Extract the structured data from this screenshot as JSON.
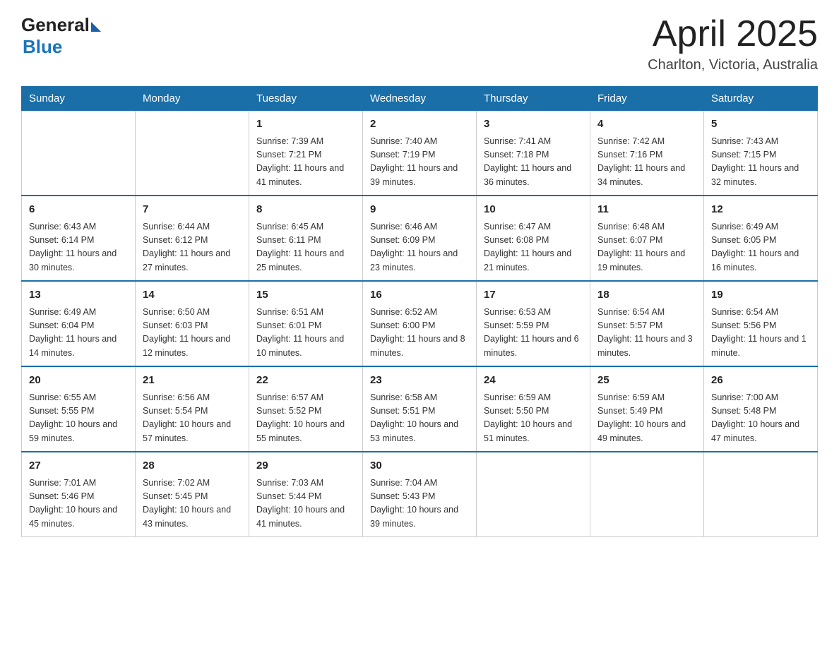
{
  "header": {
    "logo_general": "General",
    "logo_blue": "Blue",
    "title": "April 2025",
    "location": "Charlton, Victoria, Australia"
  },
  "days_of_week": [
    "Sunday",
    "Monday",
    "Tuesday",
    "Wednesday",
    "Thursday",
    "Friday",
    "Saturday"
  ],
  "weeks": [
    [
      null,
      null,
      {
        "day": "1",
        "sunrise": "7:39 AM",
        "sunset": "7:21 PM",
        "daylight": "11 hours and 41 minutes."
      },
      {
        "day": "2",
        "sunrise": "7:40 AM",
        "sunset": "7:19 PM",
        "daylight": "11 hours and 39 minutes."
      },
      {
        "day": "3",
        "sunrise": "7:41 AM",
        "sunset": "7:18 PM",
        "daylight": "11 hours and 36 minutes."
      },
      {
        "day": "4",
        "sunrise": "7:42 AM",
        "sunset": "7:16 PM",
        "daylight": "11 hours and 34 minutes."
      },
      {
        "day": "5",
        "sunrise": "7:43 AM",
        "sunset": "7:15 PM",
        "daylight": "11 hours and 32 minutes."
      }
    ],
    [
      {
        "day": "6",
        "sunrise": "6:43 AM",
        "sunset": "6:14 PM",
        "daylight": "11 hours and 30 minutes."
      },
      {
        "day": "7",
        "sunrise": "6:44 AM",
        "sunset": "6:12 PM",
        "daylight": "11 hours and 27 minutes."
      },
      {
        "day": "8",
        "sunrise": "6:45 AM",
        "sunset": "6:11 PM",
        "daylight": "11 hours and 25 minutes."
      },
      {
        "day": "9",
        "sunrise": "6:46 AM",
        "sunset": "6:09 PM",
        "daylight": "11 hours and 23 minutes."
      },
      {
        "day": "10",
        "sunrise": "6:47 AM",
        "sunset": "6:08 PM",
        "daylight": "11 hours and 21 minutes."
      },
      {
        "day": "11",
        "sunrise": "6:48 AM",
        "sunset": "6:07 PM",
        "daylight": "11 hours and 19 minutes."
      },
      {
        "day": "12",
        "sunrise": "6:49 AM",
        "sunset": "6:05 PM",
        "daylight": "11 hours and 16 minutes."
      }
    ],
    [
      {
        "day": "13",
        "sunrise": "6:49 AM",
        "sunset": "6:04 PM",
        "daylight": "11 hours and 14 minutes."
      },
      {
        "day": "14",
        "sunrise": "6:50 AM",
        "sunset": "6:03 PM",
        "daylight": "11 hours and 12 minutes."
      },
      {
        "day": "15",
        "sunrise": "6:51 AM",
        "sunset": "6:01 PM",
        "daylight": "11 hours and 10 minutes."
      },
      {
        "day": "16",
        "sunrise": "6:52 AM",
        "sunset": "6:00 PM",
        "daylight": "11 hours and 8 minutes."
      },
      {
        "day": "17",
        "sunrise": "6:53 AM",
        "sunset": "5:59 PM",
        "daylight": "11 hours and 6 minutes."
      },
      {
        "day": "18",
        "sunrise": "6:54 AM",
        "sunset": "5:57 PM",
        "daylight": "11 hours and 3 minutes."
      },
      {
        "day": "19",
        "sunrise": "6:54 AM",
        "sunset": "5:56 PM",
        "daylight": "11 hours and 1 minute."
      }
    ],
    [
      {
        "day": "20",
        "sunrise": "6:55 AM",
        "sunset": "5:55 PM",
        "daylight": "10 hours and 59 minutes."
      },
      {
        "day": "21",
        "sunrise": "6:56 AM",
        "sunset": "5:54 PM",
        "daylight": "10 hours and 57 minutes."
      },
      {
        "day": "22",
        "sunrise": "6:57 AM",
        "sunset": "5:52 PM",
        "daylight": "10 hours and 55 minutes."
      },
      {
        "day": "23",
        "sunrise": "6:58 AM",
        "sunset": "5:51 PM",
        "daylight": "10 hours and 53 minutes."
      },
      {
        "day": "24",
        "sunrise": "6:59 AM",
        "sunset": "5:50 PM",
        "daylight": "10 hours and 51 minutes."
      },
      {
        "day": "25",
        "sunrise": "6:59 AM",
        "sunset": "5:49 PM",
        "daylight": "10 hours and 49 minutes."
      },
      {
        "day": "26",
        "sunrise": "7:00 AM",
        "sunset": "5:48 PM",
        "daylight": "10 hours and 47 minutes."
      }
    ],
    [
      {
        "day": "27",
        "sunrise": "7:01 AM",
        "sunset": "5:46 PM",
        "daylight": "10 hours and 45 minutes."
      },
      {
        "day": "28",
        "sunrise": "7:02 AM",
        "sunset": "5:45 PM",
        "daylight": "10 hours and 43 minutes."
      },
      {
        "day": "29",
        "sunrise": "7:03 AM",
        "sunset": "5:44 PM",
        "daylight": "10 hours and 41 minutes."
      },
      {
        "day": "30",
        "sunrise": "7:04 AM",
        "sunset": "5:43 PM",
        "daylight": "10 hours and 39 minutes."
      },
      null,
      null,
      null
    ]
  ],
  "labels": {
    "sunrise": "Sunrise:",
    "sunset": "Sunset:",
    "daylight": "Daylight:"
  }
}
